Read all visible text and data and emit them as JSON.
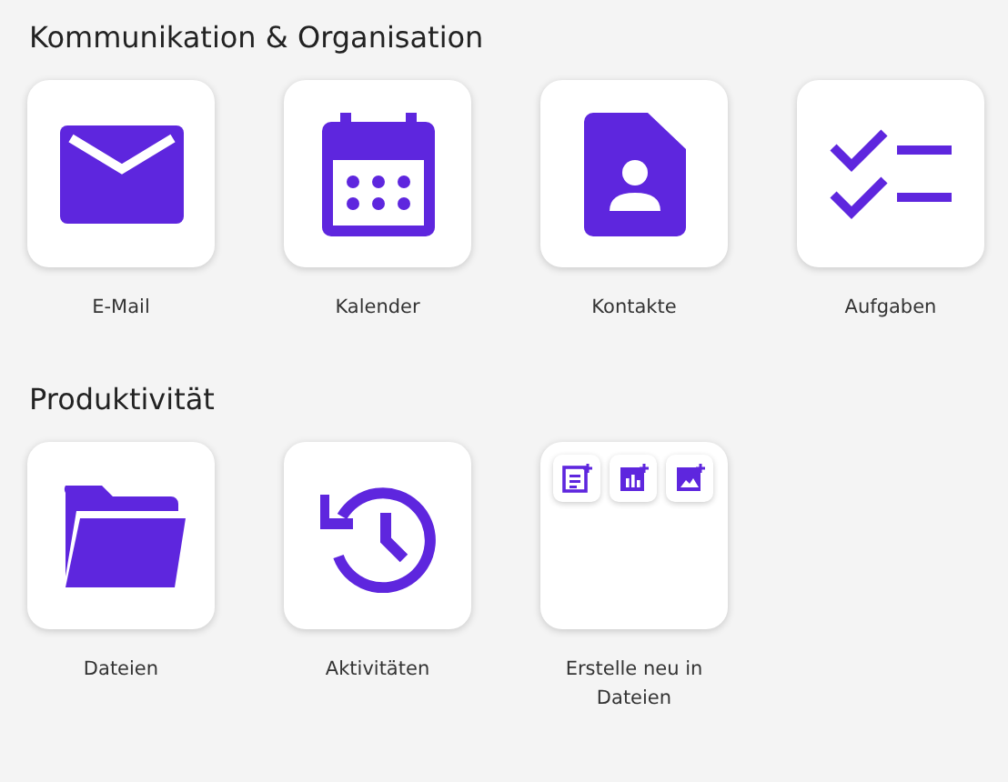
{
  "sections": [
    {
      "title": "Kommunikation & Organisation",
      "apps": [
        {
          "kind": "mail",
          "label": "E-Mail"
        },
        {
          "kind": "calendar",
          "label": "Kalender"
        },
        {
          "kind": "contacts",
          "label": "Kontakte"
        },
        {
          "kind": "tasks",
          "label": "Aufgaben"
        }
      ]
    },
    {
      "title": "Produktivität",
      "apps": [
        {
          "kind": "folder",
          "label": "Dateien"
        },
        {
          "kind": "history",
          "label": "Aktivitäten"
        },
        {
          "kind": "create",
          "label": "Erstelle neu in Dateien"
        }
      ]
    }
  ]
}
